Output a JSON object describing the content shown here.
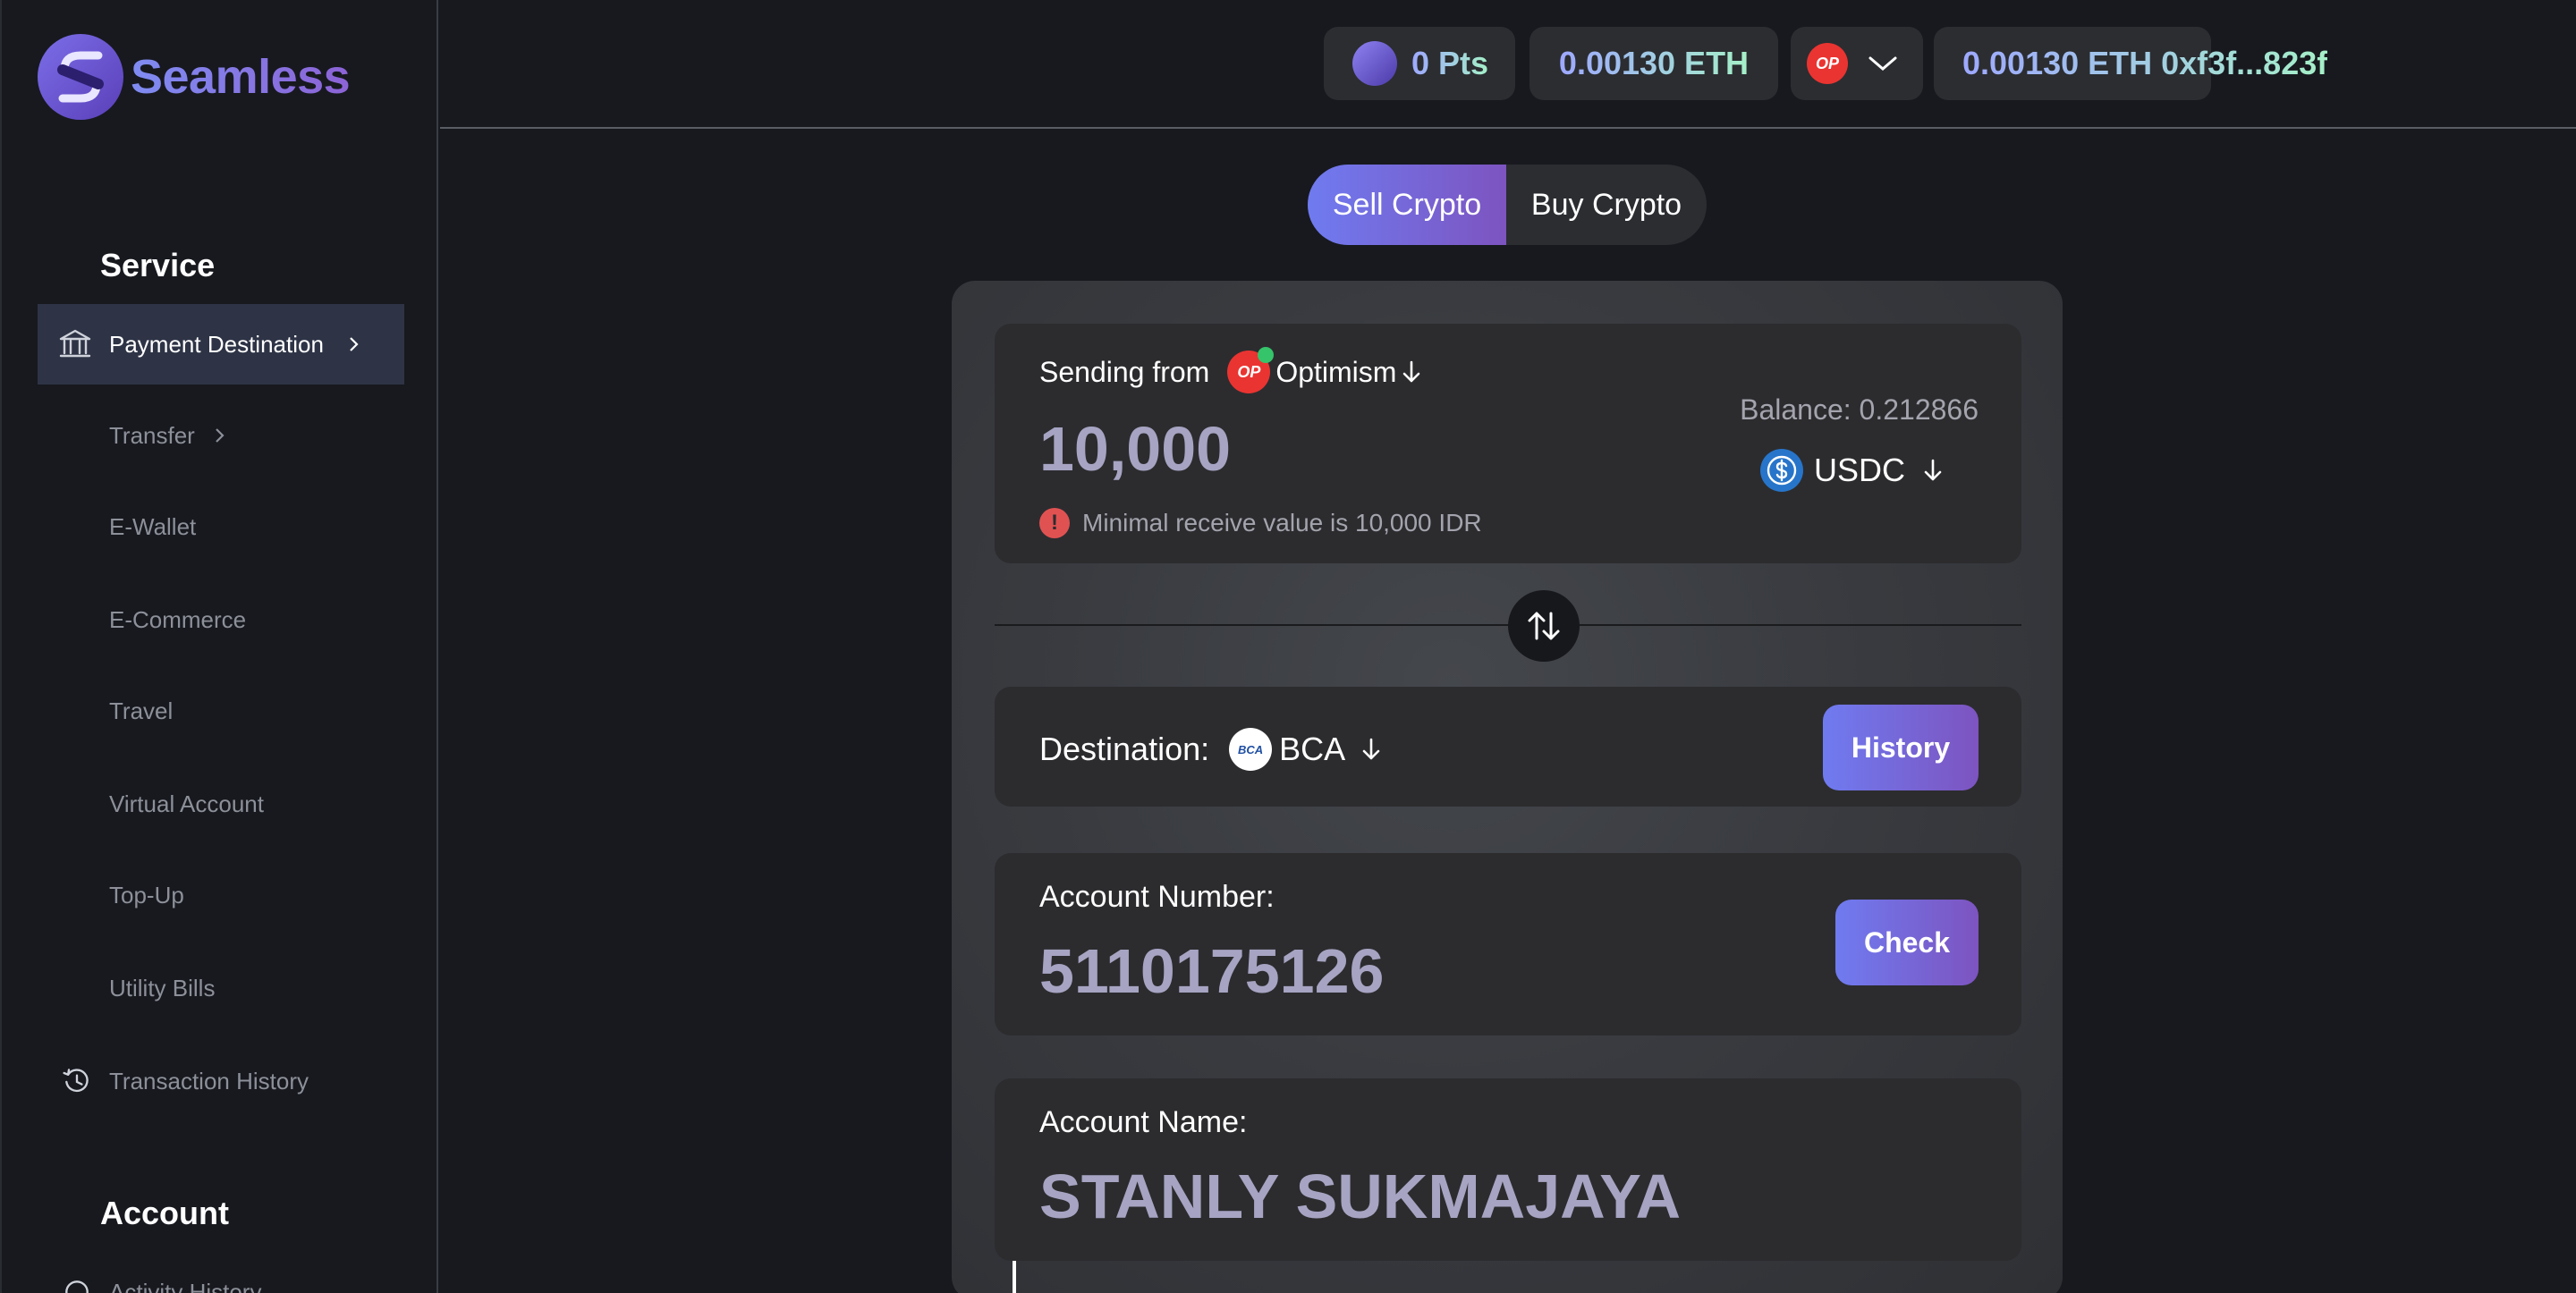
{
  "brand": {
    "name": "Seamless"
  },
  "sidebar": {
    "service_title": "Service",
    "items": [
      {
        "label": "Payment Destination",
        "icon": "bank-icon"
      },
      {
        "label": "Transfer"
      },
      {
        "label": "E-Wallet"
      },
      {
        "label": "E-Commerce"
      },
      {
        "label": "Travel"
      },
      {
        "label": "Virtual Account"
      },
      {
        "label": "Top-Up"
      },
      {
        "label": "Utility Bills"
      },
      {
        "label": "Transaction History",
        "icon": "history-icon"
      }
    ],
    "account_title": "Account",
    "account_items": [
      {
        "label": "Activity History"
      }
    ]
  },
  "topbar": {
    "points": "0 Pts",
    "eth_balance": "0.00130 ETH",
    "network_badge": "OP",
    "wallet": "0.00130 ETH 0xf3f...823f"
  },
  "toggle": {
    "sell": "Sell Crypto",
    "buy": "Buy Crypto"
  },
  "send": {
    "label": "Sending from",
    "network_badge": "OP",
    "network": "Optimism",
    "amount": "10,000",
    "balance": "Balance: 0.212866",
    "token": "USDC",
    "warning": "Minimal receive value is 10,000 IDR",
    "warning_icon": "!"
  },
  "destination": {
    "label": "Destination:",
    "bank_logo": "BCA",
    "bank": "BCA",
    "history_button": "History"
  },
  "account_number": {
    "label": "Account Number:",
    "value": "5110175126",
    "check_button": "Check"
  },
  "account_name": {
    "label": "Account Name:",
    "value": "STANLY SUKMAJAYA"
  },
  "colors": {
    "accent_start": "#6f7bf0",
    "accent_end": "#7d54c0",
    "op_red": "#ea3431",
    "usdc_blue": "#2775ca",
    "warning_red": "#e05252"
  }
}
